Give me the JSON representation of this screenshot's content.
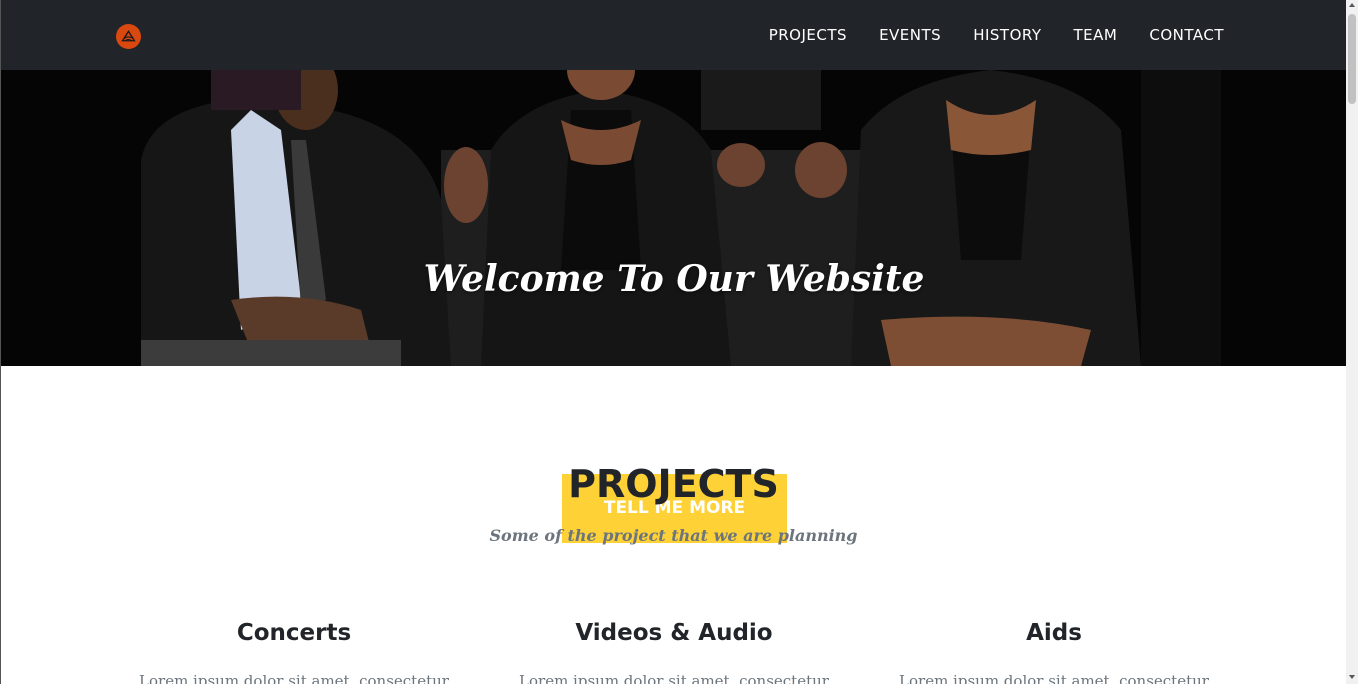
{
  "navbar": {
    "logo_icon": "church-logo-icon",
    "logo_color": "#d9480f",
    "items": [
      {
        "label": "PROJECTS"
      },
      {
        "label": "EVENTS"
      },
      {
        "label": "HISTORY"
      },
      {
        "label": "TEAM"
      },
      {
        "label": "CONTACT"
      }
    ]
  },
  "hero": {
    "title": "Welcome To Our Website"
  },
  "projects": {
    "heading": "PROJECTS",
    "button_label": "TELL ME MORE",
    "button_color": "#fed136",
    "subheading": "Some of the project that we are planning",
    "services": [
      {
        "title": "Concerts",
        "text": "Lorem ipsum dolor sit amet, consectetur"
      },
      {
        "title": "Videos & Audio",
        "text": "Lorem ipsum dolor sit amet, consectetur"
      },
      {
        "title": "Aids",
        "text": "Lorem ipsum dolor sit amet, consectetur"
      }
    ]
  }
}
